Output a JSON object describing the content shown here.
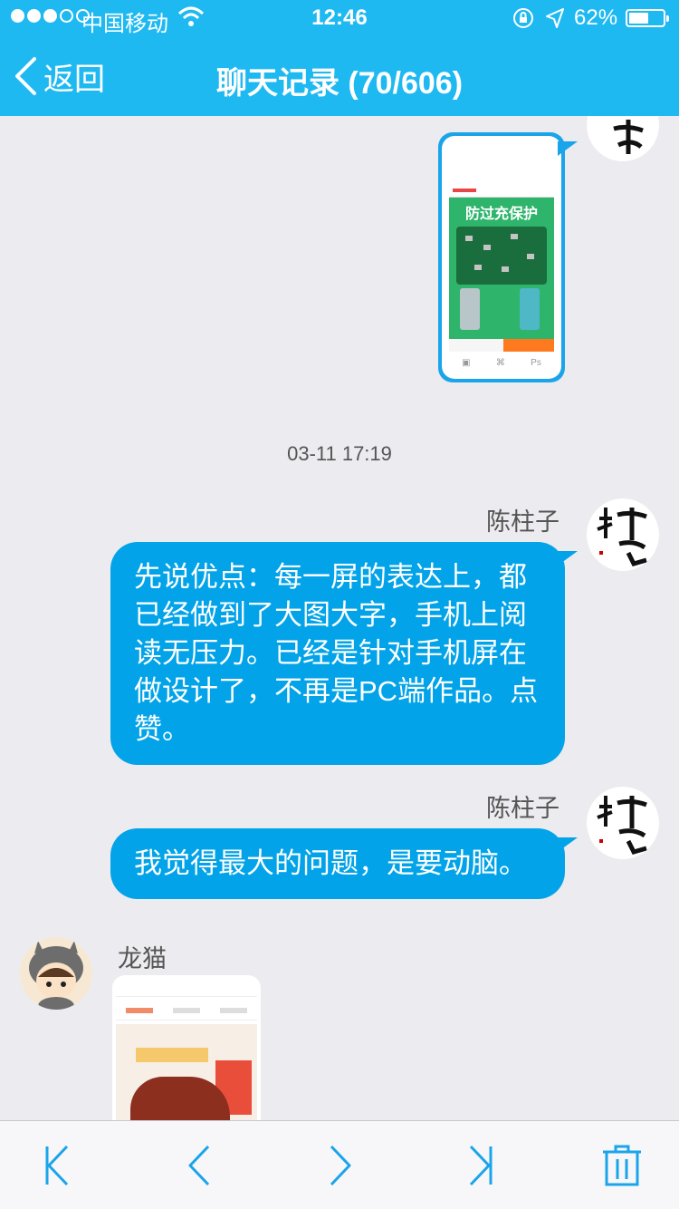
{
  "status_bar": {
    "carrier": "中国移动",
    "time": "12:46",
    "battery_percent": "62%",
    "battery_level": 0.62
  },
  "nav": {
    "back_label": "返回",
    "title": "聊天记录 (70/606)"
  },
  "messages": [
    {
      "timestamp": "03-11 17:19"
    },
    {
      "sender": "陈柱子",
      "text": "先说优点：每一屏的表达上，都已经做到了大图大字，手机上阅读无压力。已经是针对手机屏在做设计了，不再是PC端作品。点赞。"
    },
    {
      "sender": "陈柱子",
      "text": "我觉得最大的问题，是要动脑。"
    },
    {
      "sender": "龙猫"
    }
  ],
  "phone_image": {
    "promo_text": "防过充保护"
  },
  "avatar_text": {
    "main": "柱子"
  },
  "toolbar": {
    "icons": [
      "first-page-icon",
      "prev-page-icon",
      "next-page-icon",
      "last-page-icon",
      "trash-icon"
    ]
  },
  "colors": {
    "accent": "#1fb9f2",
    "bubble": "#02a3e8",
    "icon": "#1aa4ea",
    "background": "#ebebf0"
  }
}
